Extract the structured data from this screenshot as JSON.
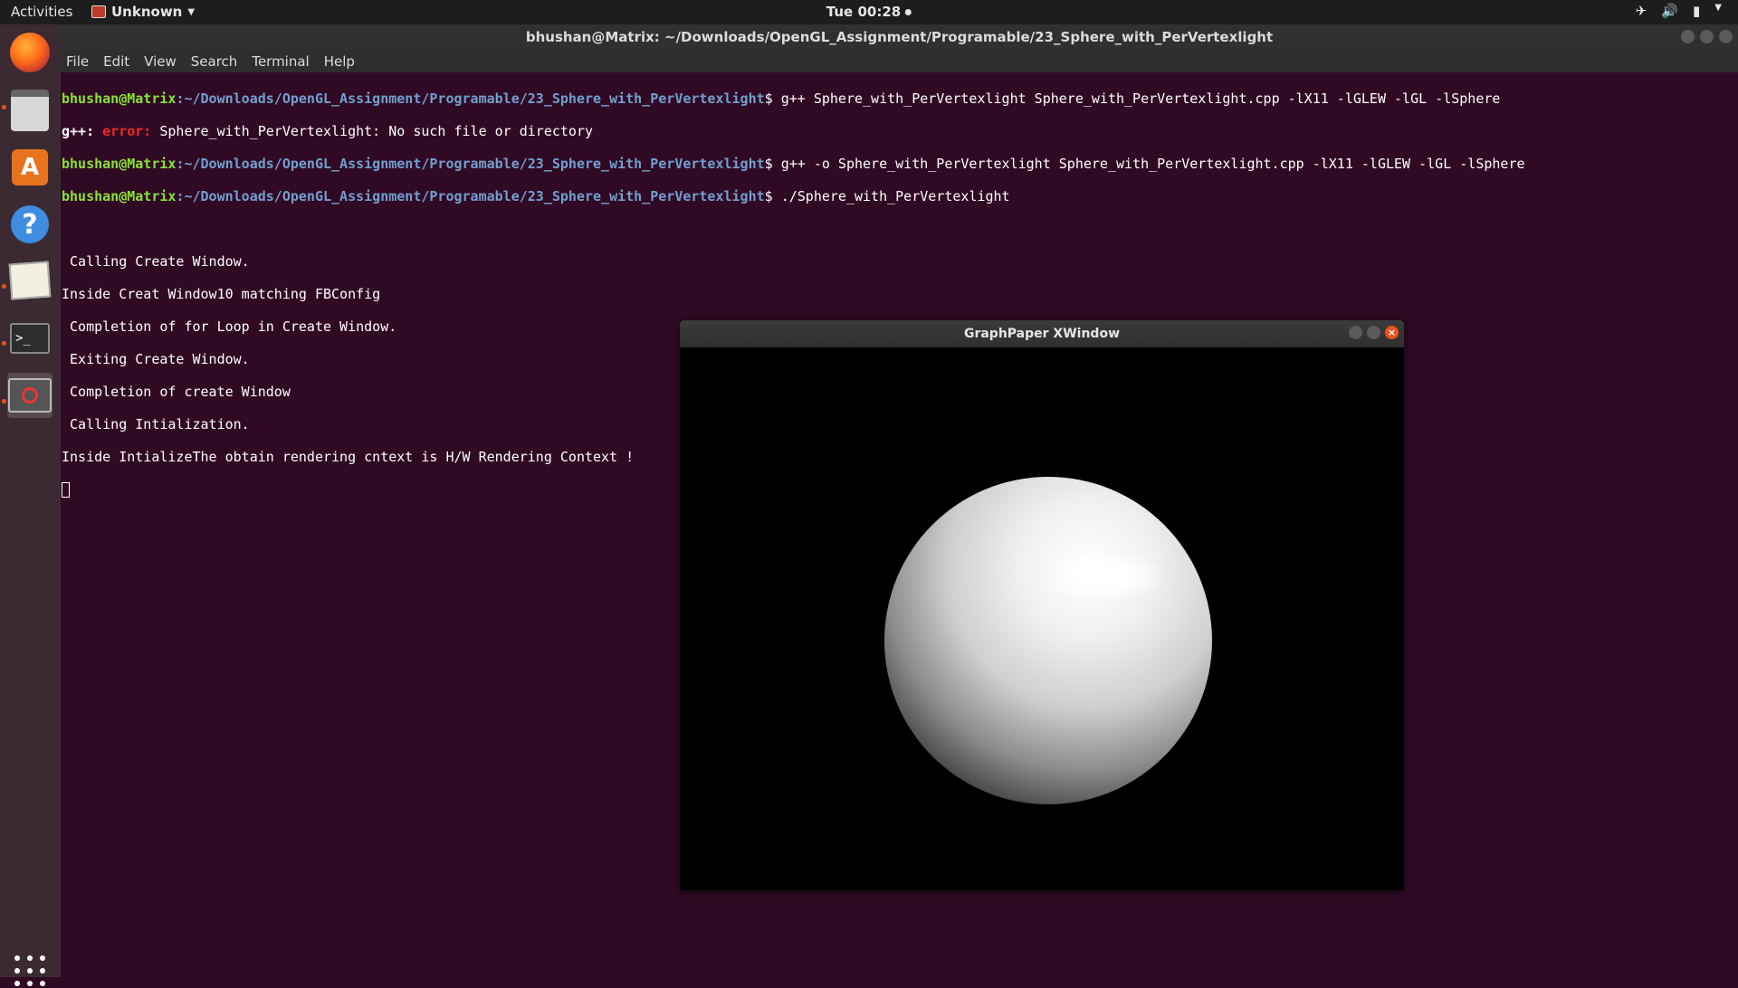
{
  "topbar": {
    "activities": "Activities",
    "app_menu": "Unknown",
    "clock": "Tue 00:28"
  },
  "launcher": {
    "items": [
      "firefox-icon",
      "files-icon",
      "software-center-icon",
      "help-icon",
      "text-editor-icon",
      "terminal-icon",
      "xwindow-app-icon"
    ]
  },
  "terminal": {
    "title": "bhushan@Matrix: ~/Downloads/OpenGL_Assignment/Programable/23_Sphere_with_PerVertexlight",
    "menu": [
      "File",
      "Edit",
      "View",
      "Search",
      "Terminal",
      "Help"
    ],
    "prompt_user": "bhushan@Matrix",
    "prompt_path": ":~/Downloads/OpenGL_Assignment/Programable/23_Sphere_with_PerVertexlight",
    "cmd1": "$ g++ Sphere_with_PerVertexlight Sphere_with_PerVertexlight.cpp -lX11 -lGLEW -lGL -lSphere",
    "err_prefix": "g++: ",
    "err_word": "error:",
    "err_msg": " Sphere_with_PerVertexlight: No such file or directory",
    "cmd2": "$ g++ -o Sphere_with_PerVertexlight Sphere_with_PerVertexlight.cpp -lX11 -lGLEW -lGL -lSphere",
    "cmd3": "$ ./Sphere_with_PerVertexlight",
    "output": [
      " Calling Create Window.",
      "Inside Creat Window10 matching FBConfig",
      " Completion of for Loop in Create Window.",
      " Exiting Create Window.",
      " Completion of create Window",
      " Calling Intialization.",
      "Inside IntializeThe obtain rendering cntext is H/W Rendering Context !"
    ]
  },
  "xwindow": {
    "title": "GraphPaper XWindow"
  }
}
